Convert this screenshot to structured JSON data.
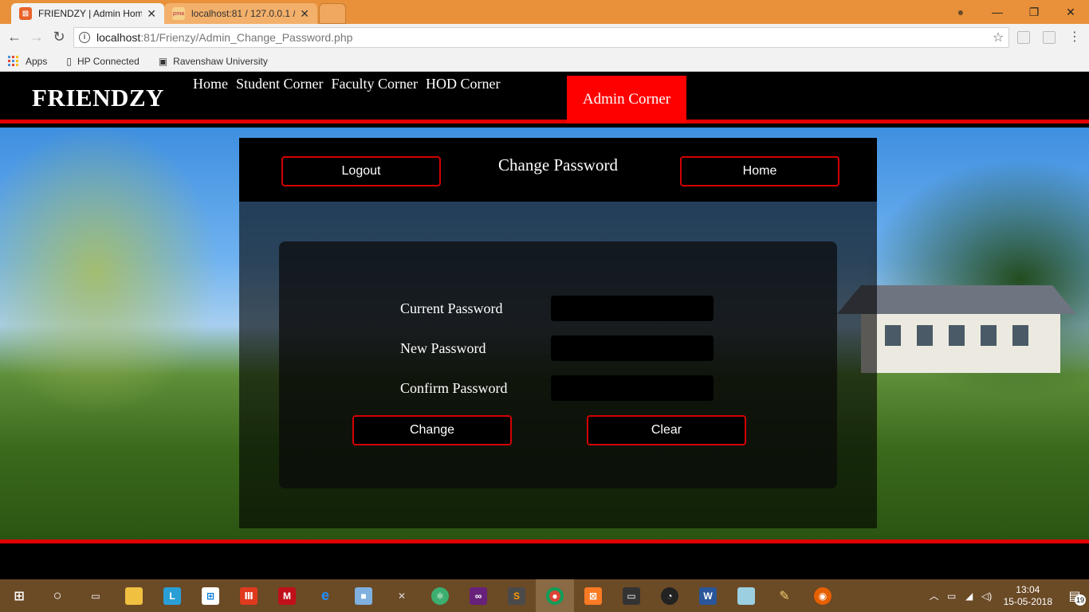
{
  "browser": {
    "tabs": [
      {
        "label": "FRIENDZY | Admin Home",
        "active": true
      },
      {
        "label": "localhost:81 / 127.0.0.1 /",
        "active": false
      }
    ],
    "url_host": "localhost",
    "url_path": ":81/Frienzy/Admin_Change_Password.php",
    "bookmarks": [
      "Apps",
      "HP Connected",
      "Ravenshaw University"
    ]
  },
  "site": {
    "brand": "FRIENDZY",
    "nav": [
      "Home",
      "Student Corner",
      "Faculty Corner",
      "HOD Corner"
    ],
    "nav_active": "Admin Corner"
  },
  "panel": {
    "title": "Change Password",
    "logout_label": "Logout",
    "home_label": "Home"
  },
  "form": {
    "current_label": "Current Password",
    "new_label": "New Password",
    "confirm_label": "Confirm Password",
    "current_value": "",
    "new_value": "",
    "confirm_value": "",
    "change_label": "Change",
    "clear_label": "Clear"
  },
  "taskbar": {
    "time": "13:04",
    "date": "15-05-2018",
    "notifications": "19"
  },
  "colors": {
    "accent_red": "#e20000",
    "tabstrip": "#e8913a",
    "taskbar": "#6b4a26"
  }
}
